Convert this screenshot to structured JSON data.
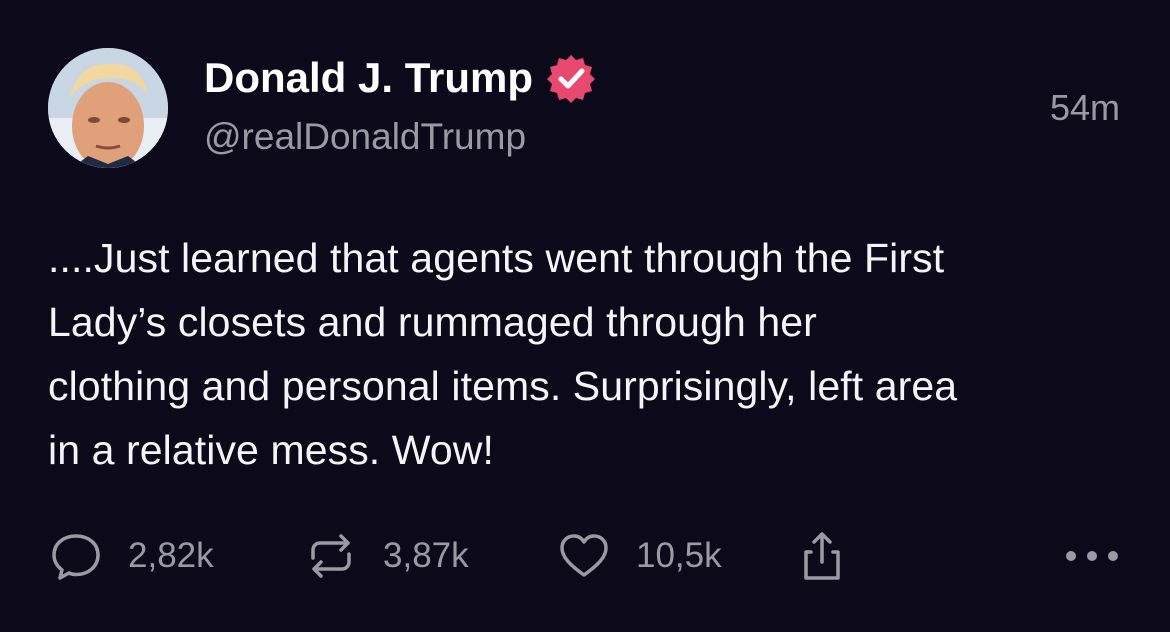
{
  "author": {
    "name": "Donald J. Trump",
    "handle": "@realDonaldTrump",
    "verified": true,
    "badge_color": "#e84a6f"
  },
  "post": {
    "timestamp": "54m",
    "text_lines": [
      "....Just learned that agents went through the First",
      "Lady’s closets and rummaged through her",
      "clothing and personal items. Surprisingly, left area",
      "in a relative mess. Wow!"
    ]
  },
  "actions": {
    "reply": {
      "icon": "speech-bubble-icon",
      "count": "2,82k"
    },
    "repost": {
      "icon": "repost-arrows-icon",
      "count": "3,87k"
    },
    "like": {
      "icon": "heart-icon",
      "count": "10,5k"
    },
    "share": {
      "icon": "share-upload-icon"
    },
    "more": {
      "icon": "more-dots-icon"
    }
  },
  "colors": {
    "background": "#0c0a1a",
    "text": "#f5f5f7",
    "muted": "#9a9aa3"
  }
}
